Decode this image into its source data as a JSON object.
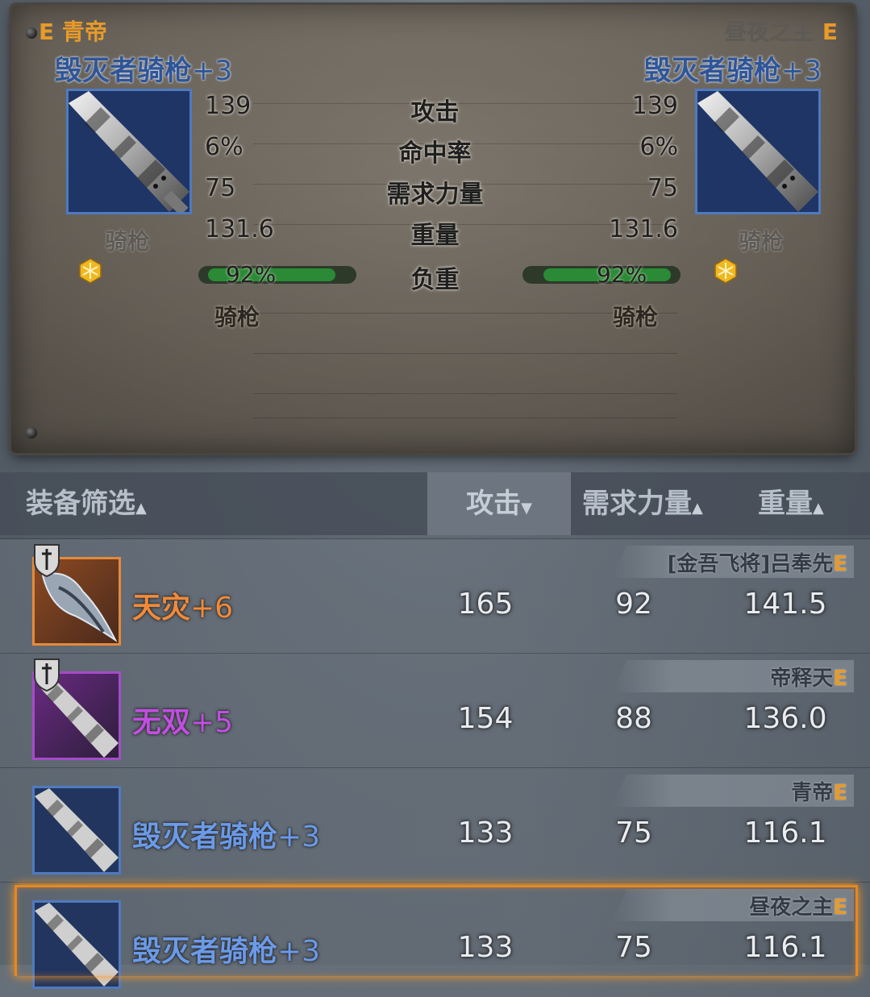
{
  "compare": {
    "left": {
      "owner_name": "青帝",
      "owner_grade": "E",
      "item_name": "毁灭者骑枪",
      "item_plus": "+3",
      "class": "骑枪",
      "attack": "139",
      "hit_rate": "6%",
      "str_req": "75",
      "weight": "131.6",
      "load_text": "92%",
      "load_fraction": 0.92,
      "subclass": "骑枪"
    },
    "right": {
      "owner_name": "昼夜之主",
      "owner_grade": "E",
      "item_name": "毁灭者骑枪",
      "item_plus": "+3",
      "class": "骑枪",
      "attack": "139",
      "hit_rate": "6%",
      "str_req": "75",
      "weight": "131.6",
      "load_text": "92%",
      "load_fraction": 0.92,
      "subclass": "骑枪"
    },
    "labels": {
      "attack": "攻击",
      "hit_rate": "命中率",
      "str_req": "需求力量",
      "weight": "重量",
      "load": "负重"
    }
  },
  "list_header": {
    "filter": "装备筛选",
    "filter_arrow": "▲",
    "attack": "攻击",
    "attack_arrow": "▼",
    "str_req": "需求力量",
    "str_req_arrow": "▲",
    "weight": "重量",
    "weight_arrow": "▲"
  },
  "rows": [
    {
      "name": "天灾",
      "plus": "+6",
      "name_color": "#f08a3a",
      "attack": "165",
      "str_req": "92",
      "weight": "141.5",
      "owner": "[金吾飞将]吕奉先",
      "owner_grade": "E",
      "rarity": "orange",
      "icon": "wing-blade-icon"
    },
    {
      "name": "无双",
      "plus": "+5",
      "name_color": "#c04fe0",
      "attack": "154",
      "str_req": "88",
      "weight": "136.0",
      "owner": "帝释天",
      "owner_grade": "E",
      "rarity": "purple",
      "icon": "lance-icon"
    },
    {
      "name": "毁灭者骑枪",
      "plus": "+3",
      "name_color": "#6b9ae8",
      "attack": "133",
      "str_req": "75",
      "weight": "116.1",
      "owner": "青帝",
      "owner_grade": "E",
      "rarity": "blue",
      "icon": "lance-icon"
    },
    {
      "name": "毁灭者骑枪",
      "plus": "+3",
      "name_color": "#6b9ae8",
      "attack": "133",
      "str_req": "75",
      "weight": "116.1",
      "owner": "昼夜之主",
      "owner_grade": "E",
      "rarity": "blue",
      "icon": "lance-icon"
    }
  ],
  "colors": {
    "grade": "#e89a2a",
    "item_blue": "#2f5597",
    "load_green": "#2a8a36",
    "selected_frame": "#e8871f"
  }
}
